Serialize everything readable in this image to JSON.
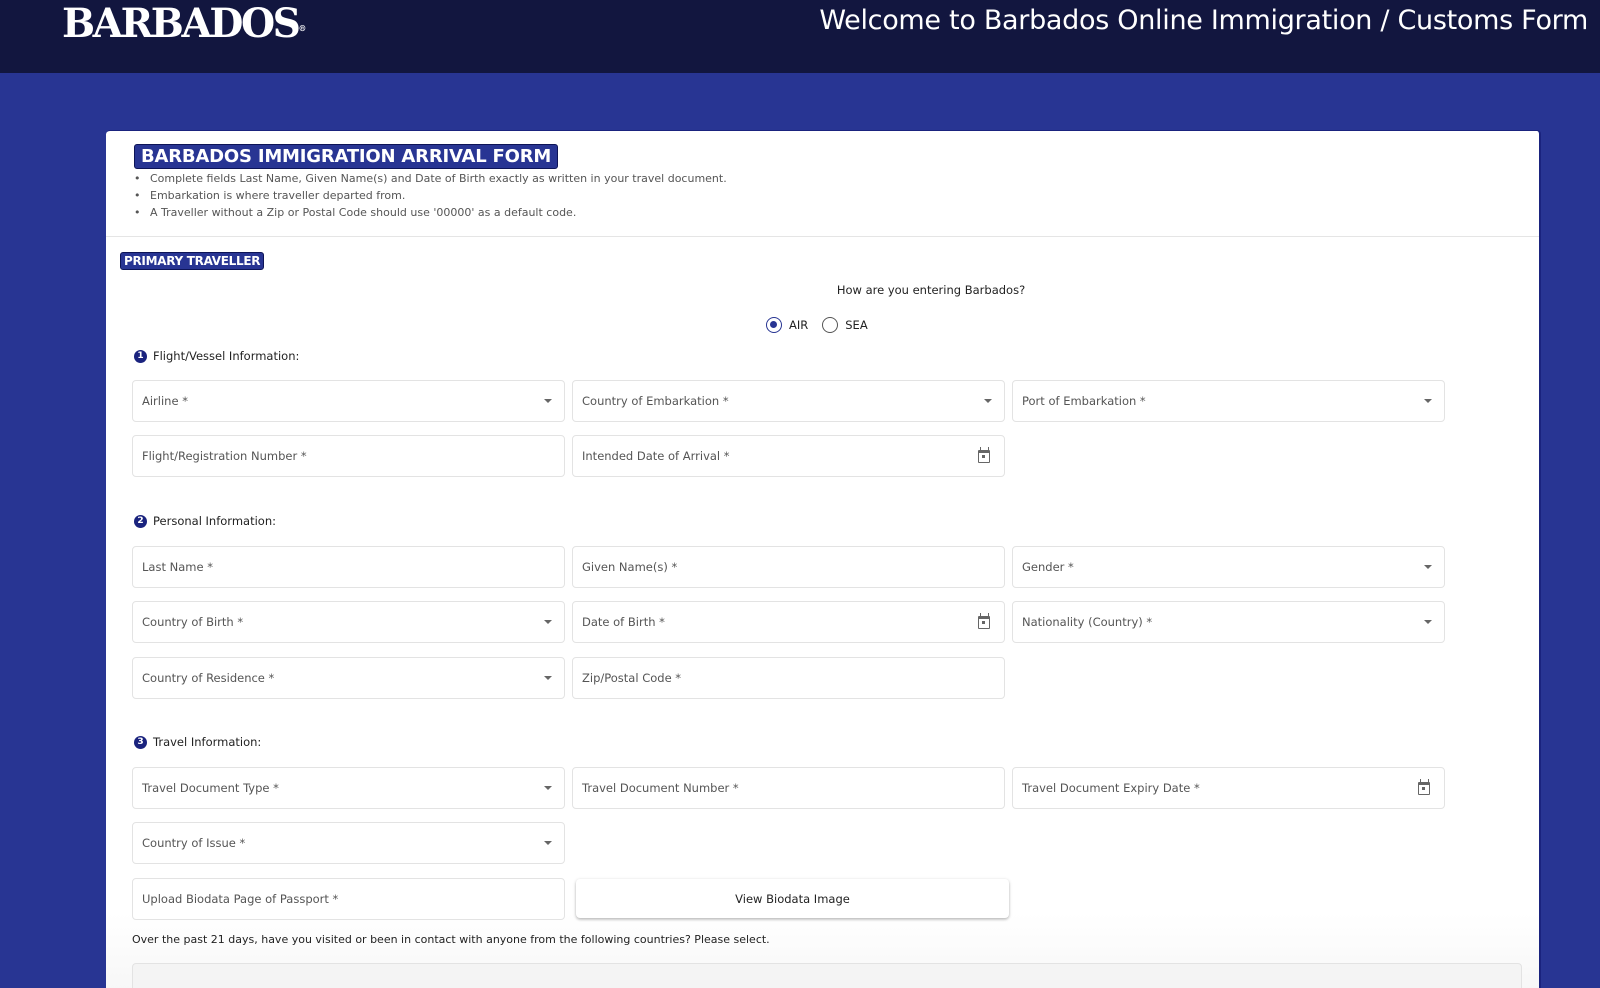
{
  "header": {
    "logo_text": "BARBADOS",
    "logo_mark": "®",
    "welcome": "Welcome to Barbados Online Immigration / Customs Form"
  },
  "colors": {
    "topbar": "#12163f",
    "page_background": "#283593",
    "accent": "#283593"
  },
  "form": {
    "title": "BARBADOS IMMIGRATION ARRIVAL FORM",
    "notes": [
      "Complete fields Last Name, Given Name(s) and Date of Birth exactly as written in your travel document.",
      "Embarkation is where traveller departed from.",
      "A Traveller without a Zip or Postal Code should use '00000' as a default code."
    ],
    "section_tag": "PRIMARY TRAVELLER",
    "entry_question": "How are you entering Barbados?",
    "entry_options": [
      {
        "label": "AIR",
        "selected": true
      },
      {
        "label": "SEA",
        "selected": false
      }
    ],
    "sections": [
      {
        "number": "1",
        "title": "Flight/Vessel Information:",
        "fields": [
          {
            "label": "Airline *",
            "type": "select"
          },
          {
            "label": "Country of Embarkation *",
            "type": "select"
          },
          {
            "label": "Port of Embarkation *",
            "type": "select"
          },
          {
            "label": "Flight/Registration Number *",
            "type": "text"
          },
          {
            "label": "Intended Date of Arrival *",
            "type": "date"
          }
        ]
      },
      {
        "number": "2",
        "title": "Personal Information:",
        "fields": [
          {
            "label": "Last Name *",
            "type": "text"
          },
          {
            "label": "Given Name(s) *",
            "type": "text"
          },
          {
            "label": "Gender *",
            "type": "select"
          },
          {
            "label": "Country of Birth *",
            "type": "select"
          },
          {
            "label": "Date of Birth *",
            "type": "date"
          },
          {
            "label": "Nationality (Country) *",
            "type": "select"
          },
          {
            "label": "Country of Residence *",
            "type": "select"
          },
          {
            "label": "Zip/Postal Code *",
            "type": "text"
          }
        ]
      },
      {
        "number": "3",
        "title": "Travel Information:",
        "fields": [
          {
            "label": "Travel Document Type *",
            "type": "select"
          },
          {
            "label": "Travel Document Number *",
            "type": "text"
          },
          {
            "label": "Travel Document Expiry Date *",
            "type": "date"
          },
          {
            "label": "Country of Issue *",
            "type": "select"
          },
          {
            "label": "Upload Biodata Page of Passport *",
            "type": "file"
          }
        ]
      }
    ],
    "view_biodata_button": "View Biodata Image",
    "contact_question": "Over the past 21 days, have you visited or been in contact with anyone from the following countries? Please select."
  }
}
